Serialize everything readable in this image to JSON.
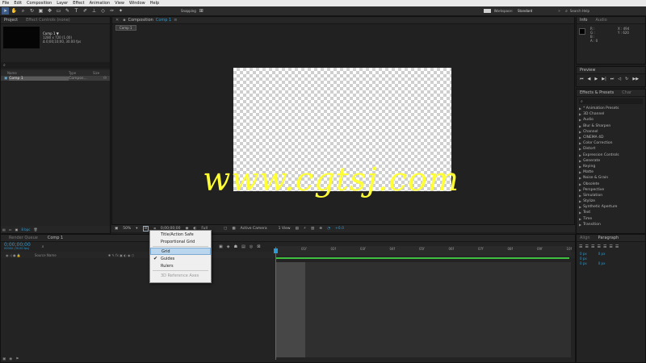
{
  "menubar": [
    "File",
    "Edit",
    "Composition",
    "Layer",
    "Effect",
    "Animation",
    "View",
    "Window",
    "Help"
  ],
  "toolbar": {
    "snapping_label": "Snapping",
    "workspace_label": "Workspace:",
    "workspace_value": "Standard",
    "search_placeholder": "Search Help"
  },
  "project": {
    "tabs": [
      "Project",
      "Effect Controls (none)"
    ],
    "comp_name": "Comp 1 ▼",
    "comp_size": "1280 x 720 (1.00)",
    "comp_duration": "Δ 0;00;10;00, 30.00 fps",
    "columns": [
      "Name",
      "Type",
      "Size"
    ],
    "items": [
      {
        "name": "Comp 1",
        "type": "Compos..."
      }
    ],
    "footer_bpc": "8 bpc"
  },
  "viewer": {
    "tab_label": "Composition",
    "tab_comp": "Comp 1",
    "breadcrumb": "Comp 1",
    "zoom": "50%",
    "timecode": "0;00;00;00",
    "resolution": "Full",
    "camera": "Active Camera",
    "views": "1 View",
    "exposure": "+0.0"
  },
  "watermark": "www.cgtsj.com",
  "grid_menu": {
    "items": [
      {
        "label": "Title/Action Safe",
        "checked": false,
        "highlighted": false,
        "disabled": false
      },
      {
        "label": "Proportional Grid",
        "checked": false,
        "highlighted": false,
        "disabled": false
      },
      {
        "label": "Grid",
        "checked": false,
        "highlighted": true,
        "disabled": false
      },
      {
        "label": "Guides",
        "checked": true,
        "highlighted": false,
        "disabled": false
      },
      {
        "label": "Rulers",
        "checked": false,
        "highlighted": false,
        "disabled": false
      },
      {
        "label": "3D Reference Axes",
        "checked": false,
        "highlighted": false,
        "disabled": true
      }
    ]
  },
  "info": {
    "tabs": [
      "Info",
      "Audio"
    ],
    "r": "R :",
    "g": "G :",
    "b": "B :",
    "a": "A : 0",
    "x": "X : 494",
    "y": "Y : 620"
  },
  "preview": {
    "title": "Preview"
  },
  "effects": {
    "tabs": [
      "Effects & Presets",
      "Char"
    ],
    "items": [
      "* Animation Presets",
      "3D Channel",
      "Audio",
      "Blur & Sharpen",
      "Channel",
      "CINEMA 4D",
      "Color Correction",
      "Distort",
      "Expression Controls",
      "Generate",
      "Keying",
      "Matte",
      "Noise & Grain",
      "Obsolete",
      "Perspective",
      "Simulation",
      "Stylize",
      "Synthetic Aperture",
      "Text",
      "Time",
      "Transition"
    ]
  },
  "timeline": {
    "tabs": [
      "Render Queue",
      "Comp 1"
    ],
    "timecode": "0;00;00;00",
    "fps": "00000 (30.00 fps)",
    "col_source": "Source Name",
    "col_parent": "Parent",
    "ticks": [
      "01f",
      "02f",
      "03f",
      "04f",
      "05f",
      "06f",
      "07f",
      "08f",
      "09f",
      "10f"
    ]
  },
  "align_para": {
    "tabs": [
      "Align",
      "Paragraph"
    ],
    "values": [
      "0 px",
      "0 px",
      "0 px",
      "0 px",
      "0 px"
    ]
  },
  "colors": {
    "accent": "#2b9bd3",
    "watermark": "#ffff33",
    "green_bar": "#3fbf3f",
    "cti": "#d43c3c"
  }
}
